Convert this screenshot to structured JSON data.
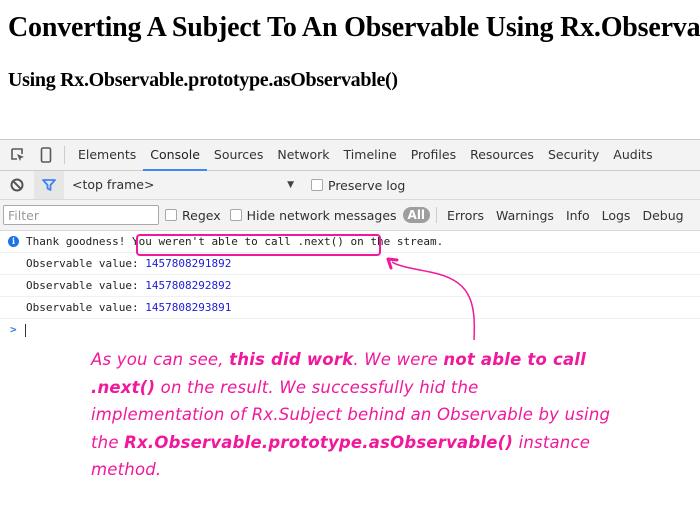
{
  "page": {
    "title": "Converting A Subject To An Observable Using Rx.Observable.prototype.asObservable()",
    "subtitle": "Using Rx.Observable.prototype.asObservable()"
  },
  "devtools": {
    "toolbar_icons": [
      "inspect-element-icon",
      "device-mode-icon"
    ],
    "tabs": [
      {
        "label": "Elements",
        "active": false
      },
      {
        "label": "Console",
        "active": true
      },
      {
        "label": "Sources",
        "active": false
      },
      {
        "label": "Network",
        "active": false
      },
      {
        "label": "Timeline",
        "active": false
      },
      {
        "label": "Profiles",
        "active": false
      },
      {
        "label": "Resources",
        "active": false
      },
      {
        "label": "Security",
        "active": false
      },
      {
        "label": "Audits",
        "active": false
      }
    ],
    "frame_select": "<top frame>",
    "preserve_log": {
      "label": "Preserve log",
      "checked": false
    },
    "filter": {
      "placeholder": "Filter",
      "value": ""
    },
    "regex": {
      "label": "Regex",
      "checked": false
    },
    "hide_network": {
      "label": "Hide network messages",
      "checked": false
    },
    "levels": {
      "all": "All",
      "items": [
        "Errors",
        "Warnings",
        "Info",
        "Logs",
        "Debug"
      ]
    },
    "accent_color": "#4285f4"
  },
  "console": {
    "info_message": {
      "prefix": "Thank goodness! ",
      "highlighted": "You weren't able to call .next()",
      "suffix": " on the stream."
    },
    "logs": [
      {
        "label": "Observable value: ",
        "value": "1457808291892"
      },
      {
        "label": "Observable value: ",
        "value": "1457808292892"
      },
      {
        "label": "Observable value: ",
        "value": "1457808293891"
      }
    ],
    "prompt": ">"
  },
  "annotation": {
    "color": "#f0189c",
    "segments": [
      {
        "text": "As you can see, ",
        "bold": false
      },
      {
        "text": "this did work",
        "bold": true
      },
      {
        "text": ". We were ",
        "bold": false
      },
      {
        "text": "not able to call .next()",
        "bold": true
      },
      {
        "text": " on the result.  We successfully hid the implementation of Rx.Subject behind an Observable by using the ",
        "bold": false
      },
      {
        "text": "Rx.Observable.prototype.asObservable()",
        "bold": true
      },
      {
        "text": " instance method.",
        "bold": false
      }
    ]
  }
}
